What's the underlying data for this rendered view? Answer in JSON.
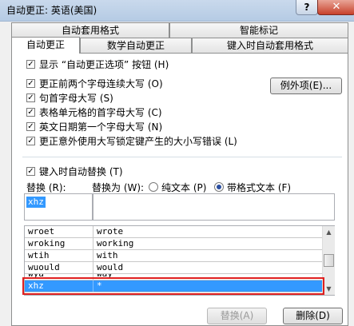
{
  "window": {
    "title": "自动更正: 英语(美国)",
    "help": "?",
    "close": "✕"
  },
  "tabs": {
    "row1": [
      "自动套用格式",
      "智能标记"
    ],
    "row2": [
      "自动更正",
      "数学自动更正",
      "键入时自动套用格式"
    ]
  },
  "options": [
    {
      "label": "显示 “自动更正选项” 按钮 (H)",
      "checked": true
    },
    {
      "label": "更正前两个字母连续大写 (O)",
      "checked": true
    },
    {
      "label": "句首字母大写 (S)",
      "checked": true
    },
    {
      "label": "表格单元格的首字母大写 (C)",
      "checked": true
    },
    {
      "label": "英文日期第一个字母大写 (N)",
      "checked": true
    },
    {
      "label": "更正意外使用大写锁定键产生的大小写错误 (L)",
      "checked": true
    }
  ],
  "exceptions_button": "例外项(E)...",
  "replace_section": {
    "checkbox_label": "键入时自动替换 (T)",
    "checked": true,
    "replace_label": "替换 (R):",
    "with_label": "替换为 (W):",
    "radio_plain": "纯文本 (P)",
    "radio_formatted": "带格式文本 (F)",
    "selected_radio": "formatted",
    "replace_value": "xhz",
    "with_value": ""
  },
  "table": {
    "rows": [
      [
        "wroet",
        "wrote"
      ],
      [
        "wroking",
        "working"
      ],
      [
        "wtih",
        "with"
      ],
      [
        "wuould",
        "would"
      ],
      [
        "wya",
        "way"
      ],
      [
        "xhz",
        "*"
      ]
    ],
    "selected_index": 5
  },
  "buttons": {
    "replace": "替换(A)",
    "delete": "删除(D)"
  }
}
